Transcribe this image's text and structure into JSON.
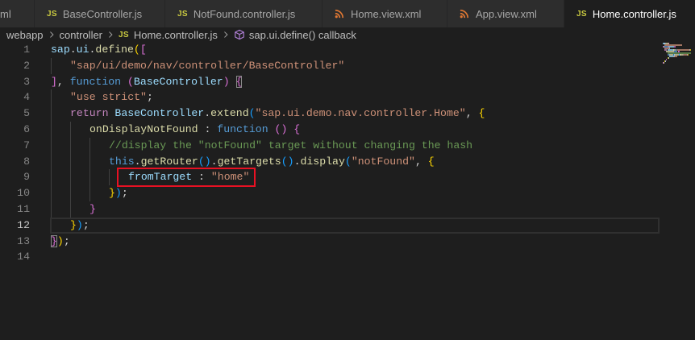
{
  "tabs": [
    {
      "label": "ml",
      "active": false
    },
    {
      "label": "BaseController.js",
      "icon": "js-file-icon",
      "icon_text": "JS",
      "active": false
    },
    {
      "label": "NotFound.controller.js",
      "icon": "js-file-icon",
      "icon_text": "JS",
      "active": false
    },
    {
      "label": "Home.view.xml",
      "icon": "xml-file-icon",
      "active": false
    },
    {
      "label": "App.view.xml",
      "icon": "xml-file-icon",
      "active": false
    },
    {
      "label": "Home.controller.js",
      "icon": "js-file-icon",
      "icon_text": "JS",
      "active": true
    }
  ],
  "breadcrumb": {
    "separator_icon": "chevron-right-icon",
    "items": [
      {
        "label": "webapp"
      },
      {
        "label": "controller"
      },
      {
        "label": "Home.controller.js",
        "icon": "js-file-icon",
        "icon_text": "JS"
      },
      {
        "label": "sap.ui.define() callback",
        "icon": "method-symbol-icon"
      }
    ]
  },
  "editor": {
    "cursor_line": 12,
    "lines": [
      {
        "number": 1,
        "indent": 0,
        "tokens": [
          {
            "text": "sap",
            "kind": "variable"
          },
          {
            "text": ".",
            "kind": "punctuation"
          },
          {
            "text": "ui",
            "kind": "variable"
          },
          {
            "text": ".",
            "kind": "punctuation"
          },
          {
            "text": "define",
            "kind": "function"
          },
          {
            "text": "(",
            "kind": "bracket-1"
          },
          {
            "text": "[",
            "kind": "bracket-2"
          }
        ]
      },
      {
        "number": 2,
        "indent": 1,
        "tokens": [
          {
            "text": "\"sap/ui/demo/nav/controller/BaseController\"",
            "kind": "string"
          }
        ]
      },
      {
        "number": 3,
        "indent": 0,
        "tokens": [
          {
            "text": "]",
            "kind": "bracket-2"
          },
          {
            "text": ", ",
            "kind": "punctuation"
          },
          {
            "text": "function",
            "kind": "keyword"
          },
          {
            "text": " ",
            "kind": "punctuation"
          },
          {
            "text": "(",
            "kind": "bracket-2"
          },
          {
            "text": "BaseController",
            "kind": "variable"
          },
          {
            "text": ")",
            "kind": "bracket-2"
          },
          {
            "text": " ",
            "kind": "punctuation"
          },
          {
            "text": "{",
            "kind": "bracket-2",
            "match": true
          }
        ]
      },
      {
        "number": 4,
        "indent": 1,
        "tokens": [
          {
            "text": "\"use strict\"",
            "kind": "string"
          },
          {
            "text": ";",
            "kind": "punctuation"
          }
        ]
      },
      {
        "number": 5,
        "indent": 1,
        "tokens": [
          {
            "text": "return",
            "kind": "control-keyword"
          },
          {
            "text": " ",
            "kind": "punctuation"
          },
          {
            "text": "BaseController",
            "kind": "variable"
          },
          {
            "text": ".",
            "kind": "punctuation"
          },
          {
            "text": "extend",
            "kind": "function"
          },
          {
            "text": "(",
            "kind": "bracket-3"
          },
          {
            "text": "\"sap.ui.demo.nav.controller.Home\"",
            "kind": "string"
          },
          {
            "text": ", ",
            "kind": "punctuation"
          },
          {
            "text": "{",
            "kind": "bracket-1"
          }
        ]
      },
      {
        "number": 6,
        "indent": 2,
        "tokens": [
          {
            "text": "onDisplayNotFound",
            "kind": "function"
          },
          {
            "text": " : ",
            "kind": "punctuation"
          },
          {
            "text": "function",
            "kind": "keyword"
          },
          {
            "text": " ",
            "kind": "punctuation"
          },
          {
            "text": "(",
            "kind": "bracket-2"
          },
          {
            "text": ")",
            "kind": "bracket-2"
          },
          {
            "text": " ",
            "kind": "punctuation"
          },
          {
            "text": "{",
            "kind": "bracket-2"
          }
        ]
      },
      {
        "number": 7,
        "indent": 3,
        "tokens": [
          {
            "text": "//display the \"notFound\" target without changing the hash",
            "kind": "comment"
          }
        ]
      },
      {
        "number": 8,
        "indent": 3,
        "tokens": [
          {
            "text": "this",
            "kind": "keyword"
          },
          {
            "text": ".",
            "kind": "punctuation"
          },
          {
            "text": "getRouter",
            "kind": "function"
          },
          {
            "text": "(",
            "kind": "bracket-3"
          },
          {
            "text": ")",
            "kind": "bracket-3"
          },
          {
            "text": ".",
            "kind": "punctuation"
          },
          {
            "text": "getTargets",
            "kind": "function"
          },
          {
            "text": "(",
            "kind": "bracket-3"
          },
          {
            "text": ")",
            "kind": "bracket-3"
          },
          {
            "text": ".",
            "kind": "punctuation"
          },
          {
            "text": "display",
            "kind": "function"
          },
          {
            "text": "(",
            "kind": "bracket-3"
          },
          {
            "text": "\"notFound\"",
            "kind": "string"
          },
          {
            "text": ", ",
            "kind": "punctuation"
          },
          {
            "text": "{",
            "kind": "bracket-1"
          }
        ]
      },
      {
        "number": 9,
        "indent": 4,
        "tokens": [
          {
            "text": "fromTarget",
            "kind": "variable",
            "boxed": true
          },
          {
            "text": " : ",
            "kind": "punctuation",
            "boxed": true
          },
          {
            "text": "\"home\"",
            "kind": "string",
            "boxed": true
          }
        ]
      },
      {
        "number": 10,
        "indent": 3,
        "tokens": [
          {
            "text": "}",
            "kind": "bracket-1"
          },
          {
            "text": ")",
            "kind": "bracket-3"
          },
          {
            "text": ";",
            "kind": "punctuation"
          }
        ]
      },
      {
        "number": 11,
        "indent": 2,
        "tokens": [
          {
            "text": "}",
            "kind": "bracket-2"
          }
        ]
      },
      {
        "number": 12,
        "indent": 1,
        "tokens": [
          {
            "text": "}",
            "kind": "bracket-1"
          },
          {
            "text": ")",
            "kind": "bracket-3"
          },
          {
            "text": ";",
            "kind": "punctuation"
          }
        ]
      },
      {
        "number": 13,
        "indent": 0,
        "tokens": [
          {
            "text": "}",
            "kind": "bracket-2",
            "match": true
          },
          {
            "text": ")",
            "kind": "bracket-1"
          },
          {
            "text": ";",
            "kind": "punctuation"
          }
        ]
      },
      {
        "number": 14,
        "indent": 0,
        "tokens": []
      }
    ]
  },
  "colors": {
    "background": "#1E1E1E",
    "tab_bar": "#252526",
    "inactive_tab": "#2D2D2D",
    "js_icon": "#CBCB41",
    "xml_icon": "#E37933",
    "symbol_icon": "#B180D7",
    "annotation_box": "#E81123",
    "tokens": {
      "variable": "#9CDCFE",
      "function": "#DCDCAA",
      "punctuation": "#D4D4D4",
      "string": "#CE9178",
      "keyword": "#569CD6",
      "control-keyword": "#C586C0",
      "comment": "#6A9955",
      "bracket-1": "#FFD700",
      "bracket-2": "#DA70D6",
      "bracket-3": "#179FFF"
    }
  }
}
